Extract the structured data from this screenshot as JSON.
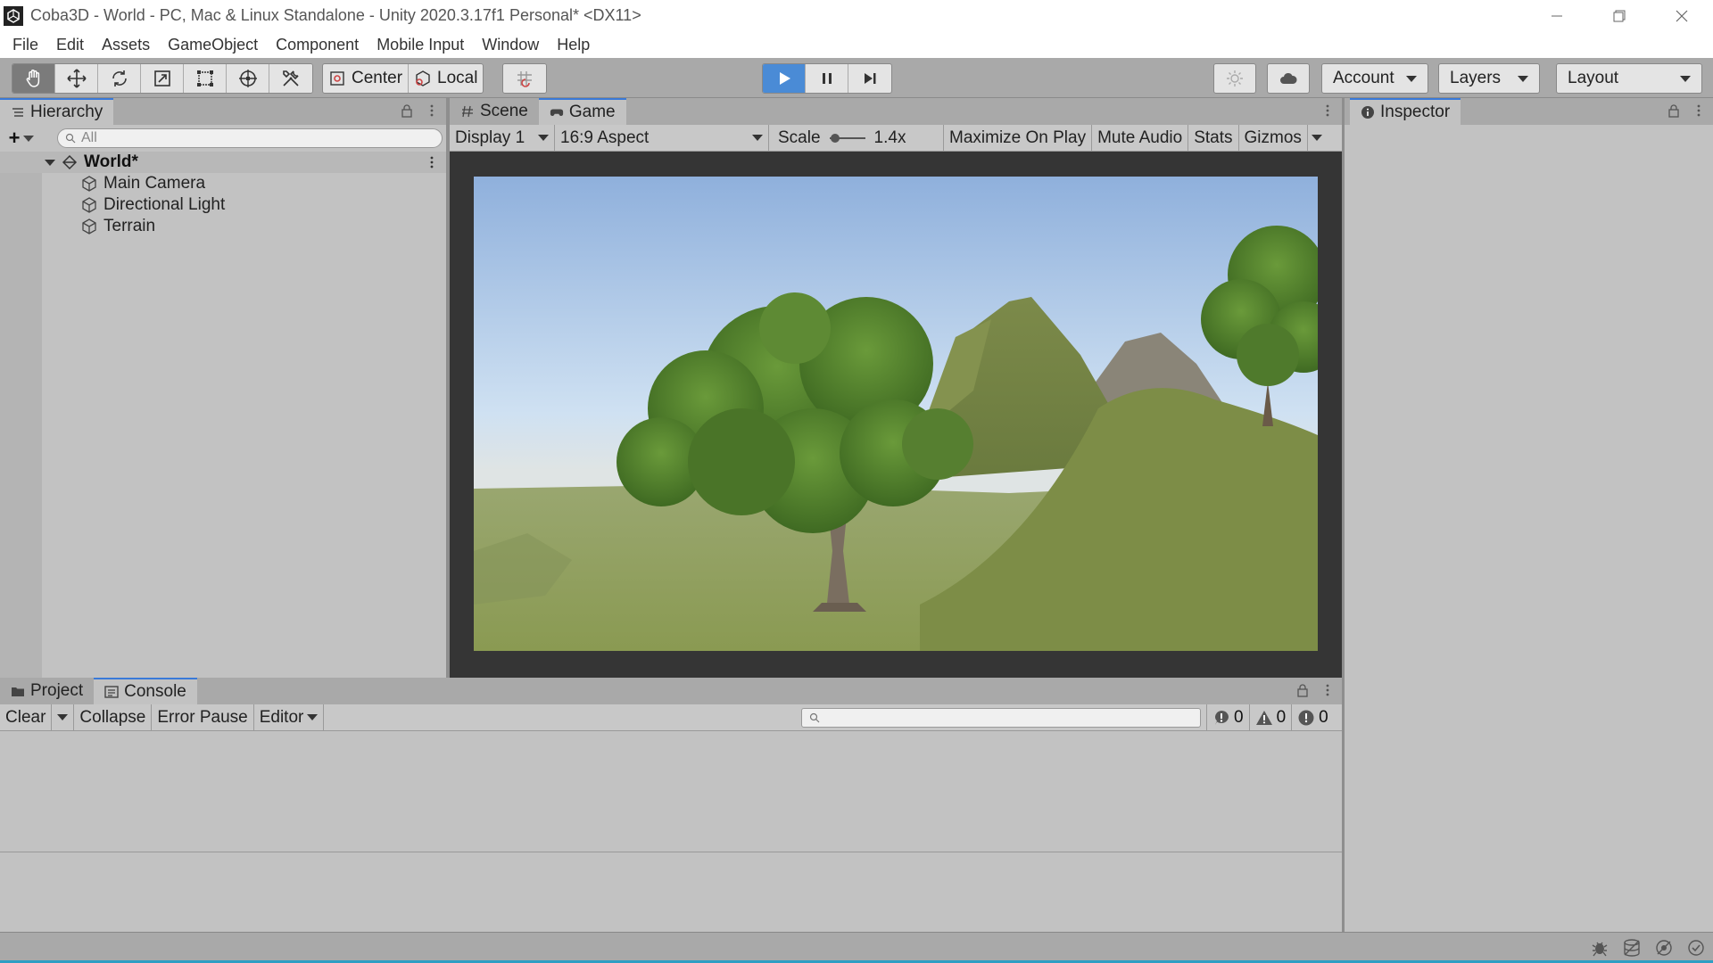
{
  "window": {
    "title": "Coba3D - World - PC, Mac & Linux Standalone - Unity 2020.3.17f1 Personal* <DX11>"
  },
  "menu": [
    "File",
    "Edit",
    "Assets",
    "GameObject",
    "Component",
    "Mobile Input",
    "Window",
    "Help"
  ],
  "toolbar": {
    "pivot_label": "Center",
    "space_label": "Local",
    "account_label": "Account",
    "layers_label": "Layers",
    "layout_label": "Layout"
  },
  "hierarchy": {
    "tab_label": "Hierarchy",
    "search_placeholder": "All",
    "scene_name": "World*",
    "objects": [
      "Main Camera",
      "Directional Light",
      "Terrain"
    ]
  },
  "center_tabs": {
    "scene_label": "Scene",
    "game_label": "Game"
  },
  "game_toolbar": {
    "display": "Display 1",
    "aspect": "16:9 Aspect",
    "scale_label": "Scale",
    "scale_value": "1.4x",
    "maximize": "Maximize On Play",
    "mute": "Mute Audio",
    "stats": "Stats",
    "gizmos": "Gizmos"
  },
  "inspector": {
    "tab_label": "Inspector"
  },
  "bottom_tabs": {
    "project_label": "Project",
    "console_label": "Console"
  },
  "console": {
    "clear": "Clear",
    "collapse": "Collapse",
    "error_pause": "Error Pause",
    "editor": "Editor",
    "log_count": "0",
    "warning_count": "0",
    "error_count": "0"
  },
  "colors": {
    "play_active": "#4a8bd6",
    "tab_accent": "#3a79d8",
    "status_accent": "#2e9ec4",
    "sky_top": "#8fb3e0",
    "grass": "#8c9c55"
  }
}
